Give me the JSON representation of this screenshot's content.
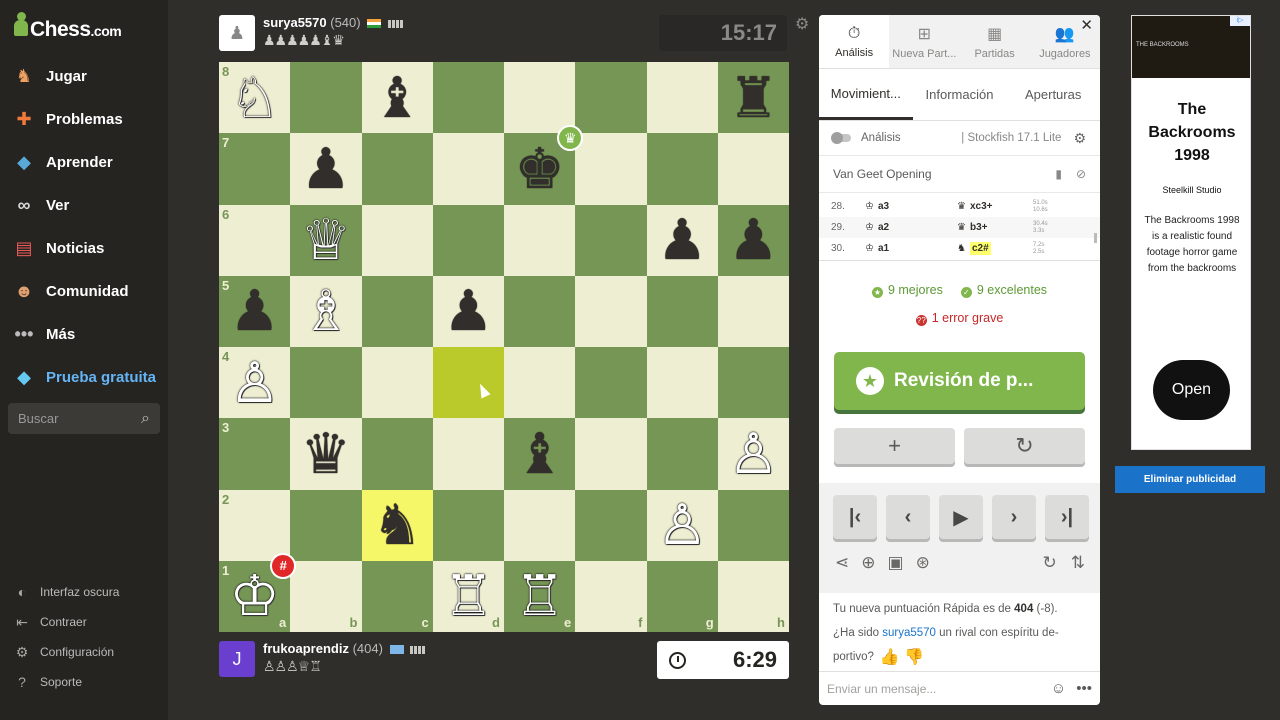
{
  "sidebar": {
    "logo_main": "Chess",
    "logo_suffix": ".com",
    "items": [
      {
        "label": "Jugar",
        "icon": "play-icon"
      },
      {
        "label": "Problemas",
        "icon": "puzzle-icon"
      },
      {
        "label": "Aprender",
        "icon": "learn-icon"
      },
      {
        "label": "Ver",
        "icon": "watch-icon"
      },
      {
        "label": "Noticias",
        "icon": "news-icon"
      },
      {
        "label": "Comunidad",
        "icon": "community-icon"
      },
      {
        "label": "Más",
        "icon": "more-icon"
      },
      {
        "label": "Prueba gratuita",
        "icon": "diamond-icon"
      }
    ],
    "search_placeholder": "Buscar",
    "bottom": [
      {
        "label": "Interfaz oscura",
        "icon": "dark-mode-icon"
      },
      {
        "label": "Contraer",
        "icon": "collapse-icon"
      },
      {
        "label": "Configuración",
        "icon": "settings-icon"
      },
      {
        "label": "Soporte",
        "icon": "help-icon"
      }
    ]
  },
  "top_player": {
    "name": "surya5570",
    "rating": "(540)",
    "captured": "♟♟♟♟♟♝♛",
    "clock": "15:17"
  },
  "bottom_player": {
    "name": "frukoaprendiz",
    "rating": "(404)",
    "avatar_letter": "J",
    "captured": "♙♙♙♕♖",
    "clock": "6:29"
  },
  "board": {
    "files": [
      "a",
      "b",
      "c",
      "d",
      "e",
      "f",
      "g",
      "h"
    ],
    "ranks": [
      "8",
      "7",
      "6",
      "5",
      "4",
      "3",
      "2",
      "1"
    ],
    "highlighted": [
      "d4",
      "c2"
    ],
    "pieces": {
      "a8": "♘w",
      "c8": "♝b",
      "h8": "♜b",
      "b7": "♟b",
      "e7": "♚b",
      "b6": "♕w",
      "g6": "♟b",
      "h6": "♟b",
      "a5": "♟b",
      "b5": "♗w",
      "d5": "♟b",
      "a4": "♙w",
      "b3": "♛b",
      "e3": "♝b",
      "h3": "♙w",
      "c2": "♞b",
      "g2": "♙w",
      "a1": "♔w",
      "d1": "♖w",
      "e1": "♖w"
    },
    "winner_square": "e7",
    "mated_square": "a1"
  },
  "panel": {
    "tabs": [
      {
        "label": "Análisis",
        "icon": "stopwatch-icon"
      },
      {
        "label": "Nueva Part...",
        "icon": "plus-icon"
      },
      {
        "label": "Partidas",
        "icon": "board-icon"
      },
      {
        "label": "Jugadores",
        "icon": "players-icon"
      }
    ],
    "subtabs": [
      "Movimient...",
      "Información",
      "Aperturas"
    ],
    "analysis_label": "Análisis",
    "engine": "Stockfish 17.1 Lite",
    "opening": "Van Geet Opening",
    "moves": [
      {
        "num": "28.",
        "white": "a3",
        "black": "xc3+",
        "wt": "51.0s",
        "bt": "10.6s"
      },
      {
        "num": "29.",
        "white": "a2",
        "black": "b3+",
        "wt": "30.4s",
        "bt": "3.3s"
      },
      {
        "num": "30.",
        "white": "a1",
        "black": "c2#",
        "wt": "7.2s",
        "bt": "2.5s"
      }
    ],
    "best": "9 mejores",
    "excellent": "9 excelentes",
    "blunder": "1 error grave",
    "review_label": "Revisión de p...",
    "chat_line1_pre": "Tu nueva puntuación Rápida es de ",
    "chat_line1_val": "404",
    "chat_line1_post": " (-8).",
    "chat_line2_pre": "¿Ha sido ",
    "chat_line2_user": "surya5570",
    "chat_line2_post": " un rival con espíritu de-portivo?",
    "message_placeholder": "Enviar un mensaje..."
  },
  "ad": {
    "image_text": "THE BACKROOMS",
    "title": "The Backrooms 1998",
    "studio": "Steelkill Studio",
    "description": "The Backrooms 1998 is a realistic found footage horror game from the backrooms",
    "button": "Open",
    "remove_label": "Eliminar publicidad"
  }
}
